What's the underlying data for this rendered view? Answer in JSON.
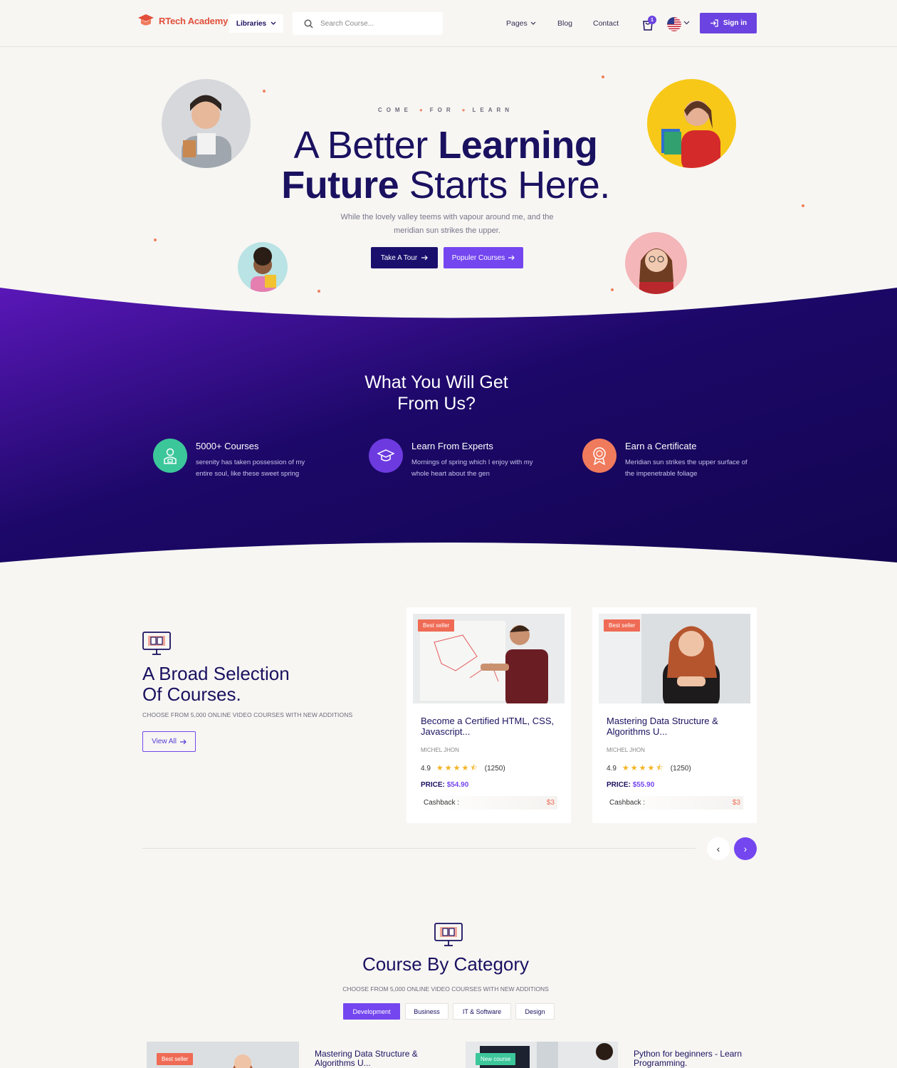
{
  "header": {
    "logo_text": "RTech Academy",
    "libraries_label": "Libraries",
    "search_placeholder": "Search Course...",
    "nav": {
      "pages": "Pages",
      "blog": "Blog",
      "contact": "Contact"
    },
    "cart_count": "1",
    "signin_label": "Sign in"
  },
  "hero": {
    "eyebrow": [
      "COME",
      "FOR",
      "LEARN"
    ],
    "title_line1_light": "A Better ",
    "title_line1_bold": "Learning",
    "title_line2_bold": "Future",
    "title_line2_light": " Starts Here.",
    "subtitle": "While the lovely valley teems with vapour around me, and the meridian sun strikes the upper.",
    "tour_button": "Take A Tour",
    "popular_button": "Populer Courses"
  },
  "benefits": {
    "title_line1": "What You Will Get",
    "title_line2": "From Us?",
    "items": [
      {
        "title": "5000+ Courses",
        "desc": "serenity has taken possession of my entire soul, like these sweet spring",
        "icon": "student-icon",
        "color": "#3cc79a"
      },
      {
        "title": "Learn From Experts",
        "desc": "Mornings of spring which I enjoy with my whole heart about the gen",
        "icon": "graduation-cap-icon",
        "color": "#6d3ae0"
      },
      {
        "title": "Earn a Certificate",
        "desc": "Meridian sun strikes the upper surface of the impenetrable foliage",
        "icon": "certificate-icon",
        "color": "#f07b5c"
      }
    ]
  },
  "broad": {
    "title_line1": "A Broad Selection",
    "title_line2": "Of Courses.",
    "subtitle": "CHOOSE FROM 5,000 ONLINE VIDEO COURSES WITH NEW ADDITIONS",
    "view_all": "View All"
  },
  "courses": [
    {
      "badge": "Best seller",
      "title": "Become a Certified HTML, CSS, Javascript...",
      "author": "MICHEL JHON",
      "rating": "4.9",
      "stars": 4.5,
      "reviews": "(1250)",
      "price_label": "PRICE:",
      "price": "$54.90",
      "cashback_label": "Cashback :",
      "cashback": "$3"
    },
    {
      "badge": "Best seller",
      "title": "Mastering Data Structure & Algorithms U...",
      "author": "MICHEL JHON",
      "rating": "4.9",
      "stars": 4.5,
      "reviews": "(1250)",
      "price_label": "PRICE:",
      "price": "$55.90",
      "cashback_label": "Cashback :",
      "cashback": "$3"
    }
  ],
  "pager": {
    "prev": "‹",
    "next": "›"
  },
  "category": {
    "title": "Course By Category",
    "subtitle": "CHOOSE FROM 5,000 ONLINE VIDEO COURSES WITH NEW ADDITIONS",
    "tabs": [
      "Development",
      "Business",
      "IT & Software",
      "Design"
    ],
    "active_tab": "Development",
    "items": [
      {
        "badge": "Best seller",
        "title": "Mastering Data Structure & Algorithms U..."
      },
      {
        "badge": "New course",
        "title": "Python for beginners - Learn Programming."
      }
    ]
  },
  "colors": {
    "primary": "#7446ef",
    "navy": "#1a0f6d",
    "accent": "#ef6b55",
    "background": "#f7f6f3"
  }
}
